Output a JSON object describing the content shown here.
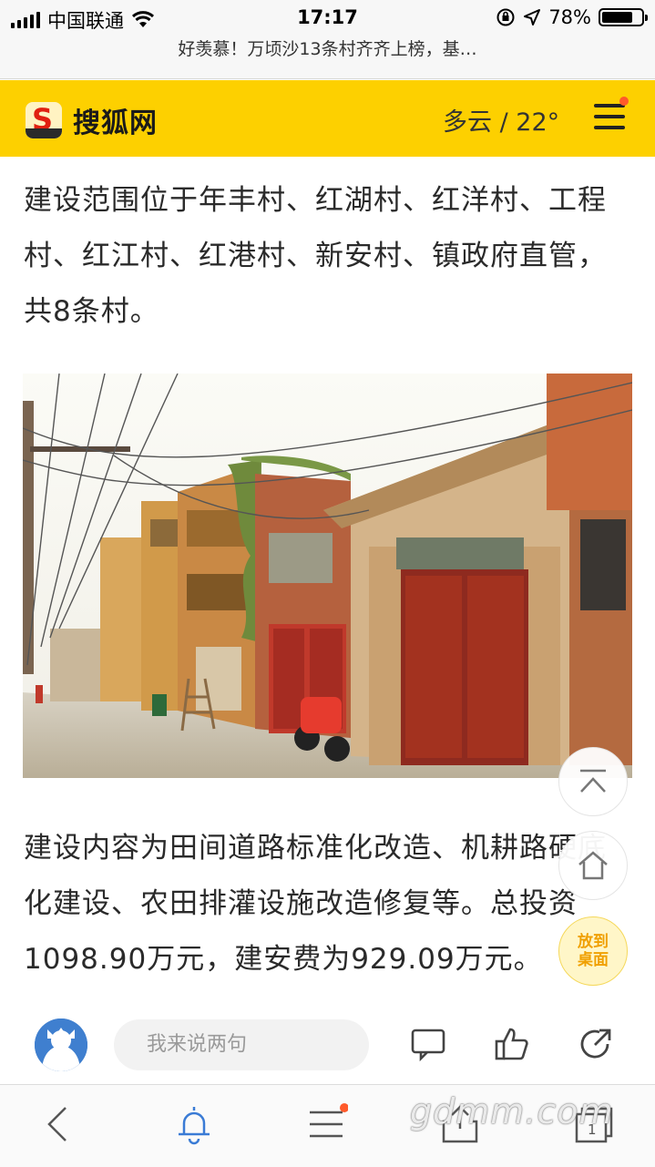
{
  "status_bar": {
    "carrier": "中国联通",
    "time": "17:17",
    "battery": "78%",
    "battery_level": 0.78
  },
  "browser": {
    "page_title": "好羡慕！万顷沙13条村齐齐上榜，基…"
  },
  "site_header": {
    "logo_letter": "S",
    "logo_text": "搜狐网",
    "weather": "多云 / 22°",
    "menu_has_notification": true
  },
  "article": {
    "paragraph_1": "建设范围位于年丰村、红湖村、红洋村、工程村、红江村、红港村、新安村、镇政府直管，共8条村。",
    "photo_alt_name": "old-village-street-photo",
    "paragraph_2": "建设内容为田间道路标准化改造、机耕路硬底化建设、农田排灌设施改造修复等。总投资1098.90万元，建安费为929.09万元。"
  },
  "floating": {
    "desk_label": "放到桌面"
  },
  "comment_bar": {
    "placeholder": "我来说两句"
  },
  "watermark": "gdmm.com",
  "colors": {
    "brand_yellow": "#fdd000",
    "notification_dot": "#ff5a2a",
    "icon_blue": "#3a7bd5"
  }
}
